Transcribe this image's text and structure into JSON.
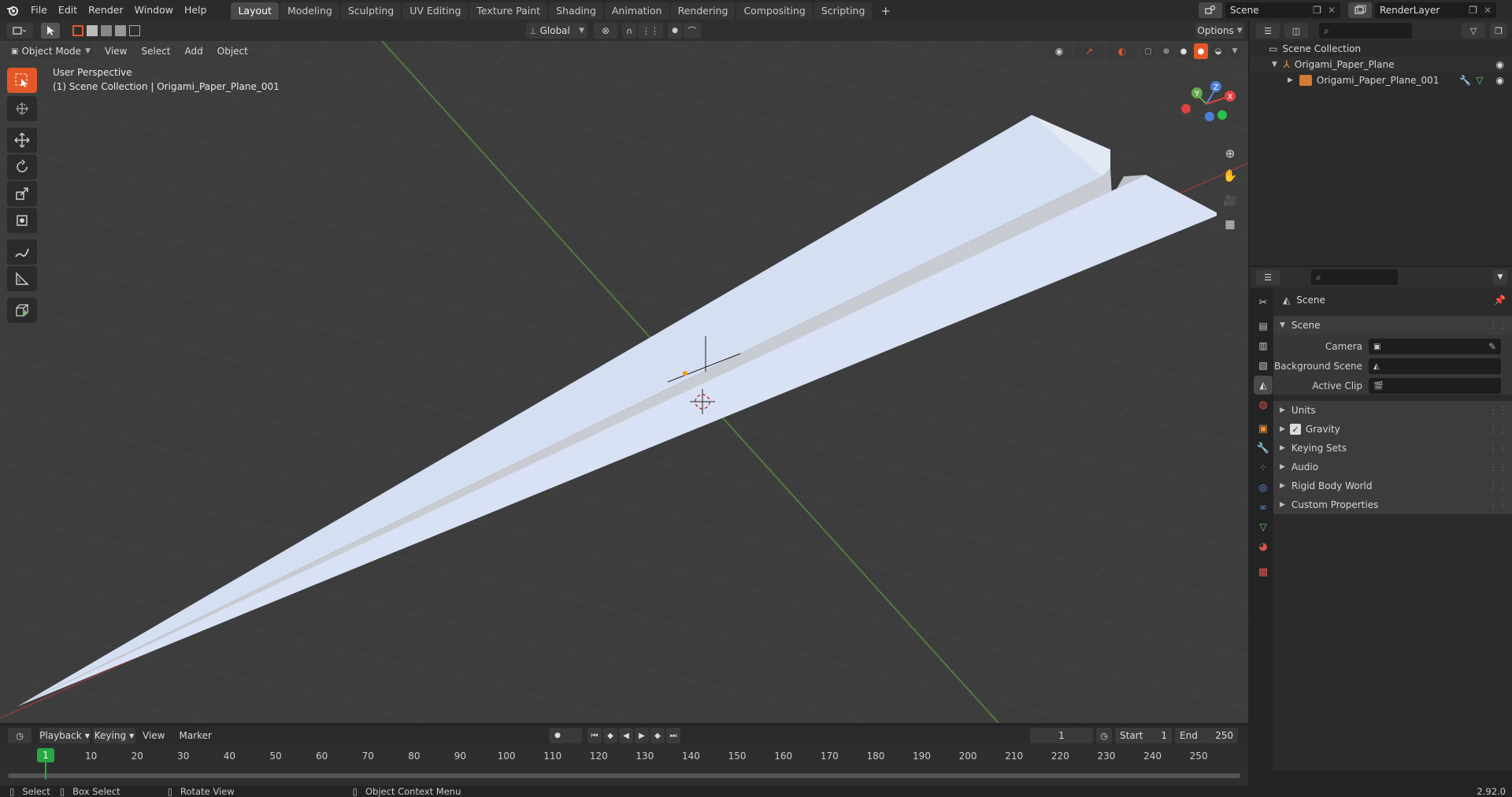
{
  "topbar": {
    "menus": [
      "File",
      "Edit",
      "Render",
      "Window",
      "Help"
    ],
    "workspaces": [
      "Layout",
      "Modeling",
      "Sculpting",
      "UV Editing",
      "Texture Paint",
      "Shading",
      "Animation",
      "Rendering",
      "Compositing",
      "Scripting"
    ],
    "active_workspace": "Layout",
    "add_workspace": "+",
    "scene_name": "Scene",
    "view_layer": "RenderLayer"
  },
  "viewport_header": {
    "transform_orientation": "Global",
    "options_label": "Options",
    "mode": "Object Mode",
    "menus": [
      "View",
      "Select",
      "Add",
      "Object"
    ]
  },
  "viewport": {
    "perspective_label": "User Perspective",
    "collection_label": "(1) Scene Collection | Origami_Paper_Plane_001",
    "gizmo_axes": {
      "x": "X",
      "y": "Y",
      "z": "Z"
    },
    "colors": {
      "x_axis": "#e04040",
      "y_axis": "#6aa84f",
      "z_axis": "#4a7fd9",
      "active_tool": "#e45828"
    }
  },
  "outliner": {
    "root": "Scene Collection",
    "items": [
      {
        "label": "Origami_Paper_Plane",
        "level": 1
      },
      {
        "label": "Origami_Paper_Plane_001",
        "level": 2
      }
    ]
  },
  "properties": {
    "breadcrumb": "Scene",
    "scene_panel_title": "Scene",
    "fields": [
      {
        "label": "Camera",
        "value": ""
      },
      {
        "label": "Background Scene",
        "value": ""
      },
      {
        "label": "Active Clip",
        "value": ""
      }
    ],
    "subpanels": [
      "Units",
      "Gravity",
      "Keying Sets",
      "Audio",
      "Rigid Body World",
      "Custom Properties"
    ],
    "gravity_checked": true
  },
  "timeline": {
    "menus": [
      "Playback",
      "Keying",
      "View",
      "Marker"
    ],
    "current_frame": "1",
    "start_label": "Start",
    "start_value": "1",
    "end_label": "End",
    "end_value": "250",
    "ruler": [
      "10",
      "20",
      "30",
      "40",
      "50",
      "60",
      "70",
      "80",
      "90",
      "100",
      "110",
      "120",
      "130",
      "140",
      "150",
      "160",
      "170",
      "180",
      "190",
      "200",
      "210",
      "220",
      "230",
      "240",
      "250"
    ],
    "playhead_label": "1"
  },
  "statusbar": {
    "select": "Select",
    "box_select": "Box Select",
    "rotate_view": "Rotate View",
    "context_menu": "Object Context Menu",
    "version": "2.92.0"
  }
}
